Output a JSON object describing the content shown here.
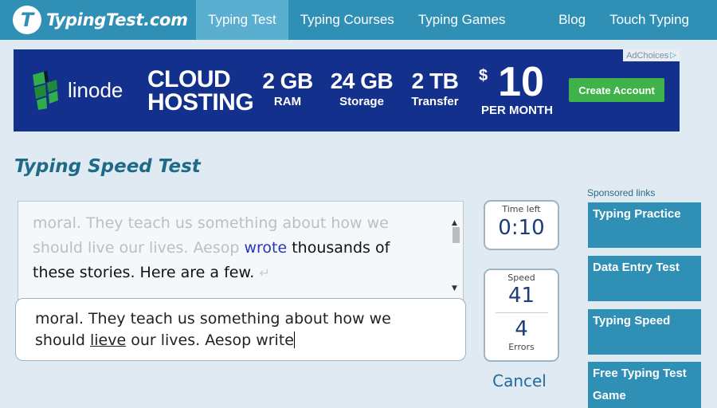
{
  "header": {
    "logo_mark": "T",
    "logo_text": "TypingTest.com",
    "nav": [
      "Typing Test",
      "Typing Courses",
      "Typing Games"
    ],
    "nav_right": [
      "Blog",
      "Touch Typing"
    ],
    "active_tab": "Typing Test"
  },
  "ad": {
    "adchoices": "AdChoices",
    "brand": "linode",
    "headline_line1": "CLOUD",
    "headline_line2": "HOSTING",
    "specs": [
      {
        "value": "2 GB",
        "label": "RAM"
      },
      {
        "value": "24 GB",
        "label": "Storage"
      },
      {
        "value": "2 TB",
        "label": "Transfer"
      }
    ],
    "currency": "$",
    "price": "10",
    "per": "PER MONTH",
    "cta": "Create Account"
  },
  "page_title": "Typing Speed Test",
  "source_text": {
    "done_line1": "moral. They teach us something about how we",
    "done_line2": "should live our lives. Aesop ",
    "current_word": "wrote",
    "rest_line2": " thousands of",
    "line3": "these stories. Here are a few.",
    "return_symbol": "↵"
  },
  "typed_text": {
    "line1": "moral. They teach us something about how we",
    "line2_before": "should ",
    "error_word": "lieve",
    "line2_after": " our lives. Aesop write"
  },
  "stats": {
    "time_label": "Time left",
    "time_value": "0:10",
    "speed_label": "Speed",
    "speed_value": "41",
    "errors_value": "4",
    "errors_label": "Errors",
    "cancel": "Cancel"
  },
  "sponsored": {
    "label": "Sponsored links",
    "links": [
      "Typing Practice",
      "Data Entry Test",
      "Typing Speed",
      "Free Typing Test Game"
    ]
  },
  "colors": {
    "nav_bg": "#2f8fb5",
    "nav_active": "#5aaed0",
    "ad_bg": "#12308c",
    "cta_green": "#3fb34a",
    "title": "#1f6a86",
    "current_word": "#2a35b5"
  }
}
